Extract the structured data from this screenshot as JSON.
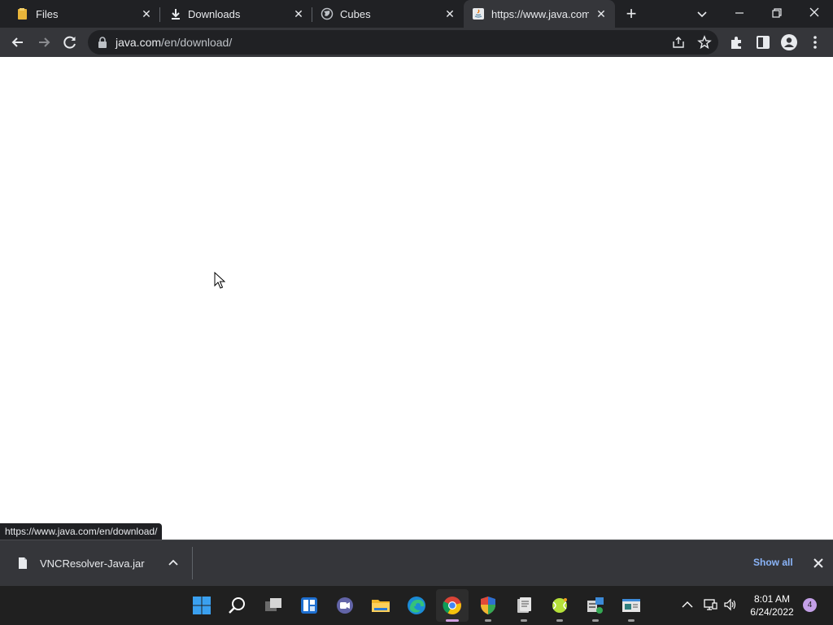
{
  "browser": {
    "tabs": [
      {
        "title": "Files",
        "icon": "folder-icon",
        "active": false
      },
      {
        "title": "Downloads",
        "icon": "download-icon",
        "active": false
      },
      {
        "title": "Cubes",
        "icon": "globe-icon",
        "active": false
      },
      {
        "title": "https://www.java.com/en/download/",
        "icon": "java-icon",
        "active": true
      }
    ],
    "url_host": "java.com",
    "url_path": "/en/download/",
    "status_url": "https://www.java.com/en/download/"
  },
  "download_shelf": {
    "file_name": "VNCResolver-Java.jar",
    "show_all_label": "Show all"
  },
  "taskbar": {
    "apps": [
      "start-icon",
      "search-icon",
      "task-view-icon",
      "widgets-icon",
      "teams-chat-icon",
      "file-explorer-icon",
      "edge-icon",
      "chrome-icon",
      "security-shield-icon",
      "scripts-icon",
      "tennis-ball-icon",
      "network-tool-icon",
      "terminal-window-icon"
    ],
    "time": "8:01 AM",
    "date": "6/24/2022",
    "notification_count": "4"
  },
  "colors": {
    "tab_strip": "#202124",
    "toolbar": "#35363a",
    "accent_link": "#8ab4f8",
    "taskbar": "#202020"
  }
}
